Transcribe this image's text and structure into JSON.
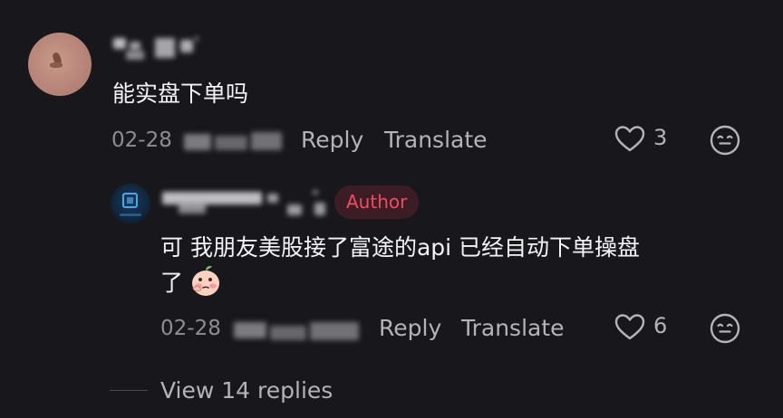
{
  "comment": {
    "text": "能实盘下单吗",
    "date": "02-28",
    "reply_label": "Reply",
    "translate_label": "Translate",
    "like_count": "3",
    "like_icon": "heart-outline-icon",
    "emoji_icon": "smiley-icon"
  },
  "reply": {
    "badge": "Author",
    "text_line1": "可 我朋友美股接了富途的api 已经自动下单操盘",
    "text_line2": "了",
    "inline_emoji": "peach-thinking-emoji",
    "date": "02-28",
    "reply_label": "Reply",
    "translate_label": "Translate",
    "like_count": "6",
    "like_icon": "heart-outline-icon",
    "emoji_icon": "smiley-icon"
  },
  "view_replies": "View 14 replies",
  "colors": {
    "background": "#18171c",
    "author_badge_text": "#f04c62",
    "author_badge_bg": "#3c1c25",
    "meta_text": "#8e8d93"
  }
}
